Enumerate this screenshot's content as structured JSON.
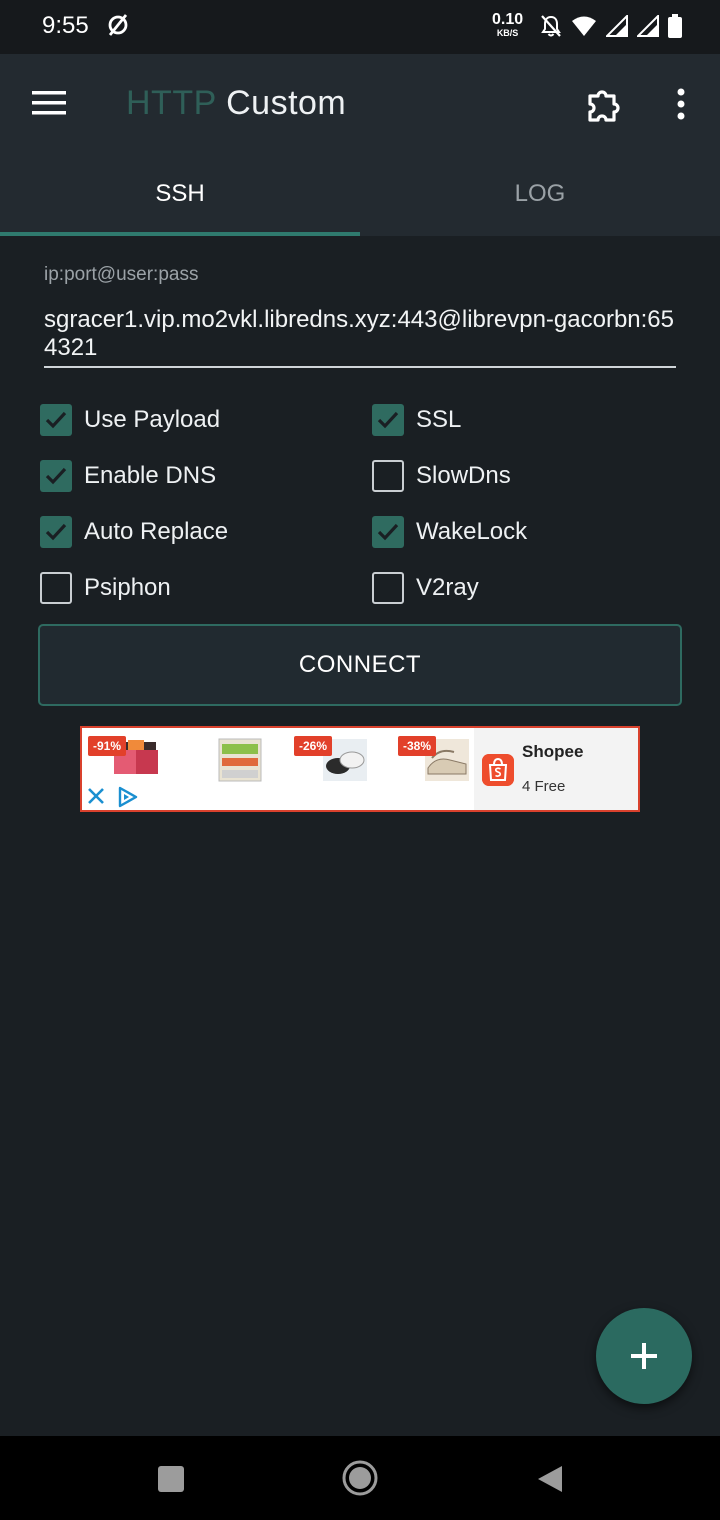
{
  "status_bar": {
    "time": "9:55",
    "net_speed_value": "0.10",
    "net_speed_unit": "KB/S",
    "icons": [
      "no-sim-icon",
      "mute-bell-icon",
      "wifi-icon",
      "signal-icon",
      "signal-icon",
      "battery-icon"
    ]
  },
  "app_bar": {
    "title_part1": "HTTP",
    "title_part2": "Custom",
    "menu_icon": "hamburger-menu-icon",
    "plugin_icon": "puzzle-piece-icon",
    "more_icon": "more-vertical-icon"
  },
  "tabs": [
    {
      "label": "SSH",
      "selected": true
    },
    {
      "label": "LOG",
      "selected": false
    }
  ],
  "ssh_field": {
    "label": "ip:port@user:pass",
    "value": "sgracer1.vip.mo2vkl.libredns.xyz:443@librevpn-gacorbn:654321"
  },
  "options": [
    {
      "label": "Use Payload",
      "checked": true
    },
    {
      "label": "SSL",
      "checked": true
    },
    {
      "label": "Enable DNS",
      "checked": true
    },
    {
      "label": "SlowDns",
      "checked": false
    },
    {
      "label": "Auto Replace",
      "checked": true
    },
    {
      "label": "WakeLock",
      "checked": true
    },
    {
      "label": "Psiphon",
      "checked": false
    },
    {
      "label": "V2ray",
      "checked": false
    }
  ],
  "connect_label": "CONNECT",
  "ad": {
    "discounts": [
      "-91%",
      "-26%",
      "-38%"
    ],
    "advertiser": "Shopee",
    "subtitle": "4 Free"
  },
  "colors": {
    "accent": "#2f6b60",
    "background": "#1a1f23",
    "appbar": "#232a30"
  }
}
